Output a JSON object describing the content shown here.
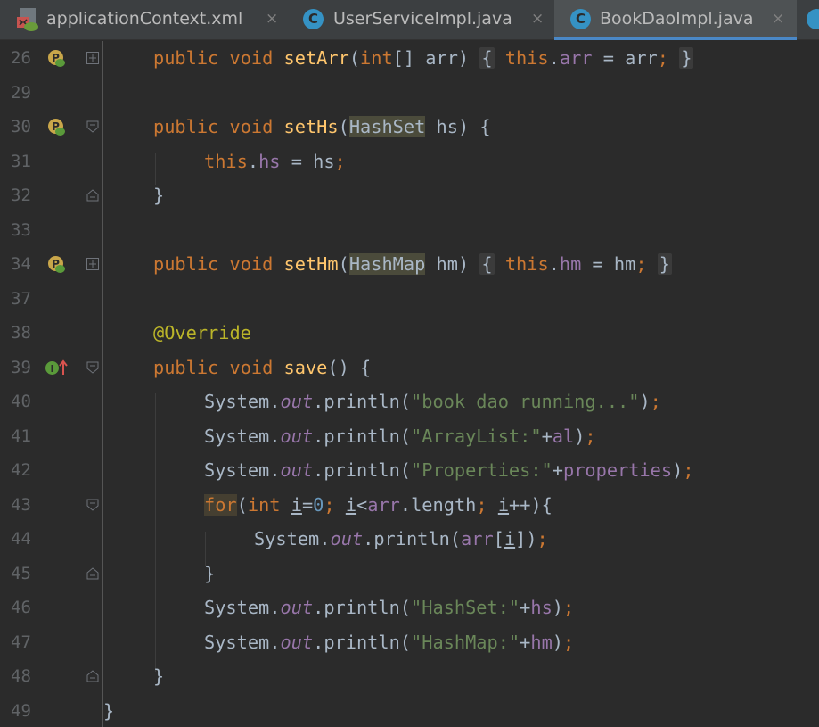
{
  "tabs": [
    {
      "label": "applicationContext.xml",
      "icon": "xml-file-icon",
      "active": false
    },
    {
      "label": "UserServiceImpl.java",
      "icon": "java-class-icon",
      "active": false
    },
    {
      "label": "BookDaoImpl.java",
      "icon": "java-class-icon",
      "active": true
    }
  ],
  "tab_close_glyph": "×",
  "colors": {
    "keyword": "#cc7832",
    "method": "#ffc66d",
    "field": "#9876aa",
    "string": "#6a8759",
    "annotation": "#bbb529",
    "number": "#6897bb",
    "text": "#a9b7c6",
    "background": "#2b2b2b",
    "active_tab_underline": "#4a88c7"
  },
  "line_numbers": [
    "26",
    "29",
    "30",
    "31",
    "32",
    "33",
    "34",
    "37",
    "38",
    "39",
    "40",
    "41",
    "42",
    "43",
    "44",
    "45",
    "46",
    "47",
    "48",
    "49"
  ],
  "code": {
    "l26": {
      "kw1": "public",
      "kw2": "void",
      "name": "setArr",
      "p1": "(",
      "type": "int",
      "p2": "[] arr) ",
      "ob": "{",
      "sp": " ",
      "this": "this",
      "dot": ".",
      "field": "arr",
      "rest": " = arr",
      "semi": ";",
      "sp2": " ",
      "cb": "}"
    },
    "l30": {
      "kw1": "public",
      "kw2": "void",
      "name": "setHs",
      "p1": "(",
      "type": "HashSet",
      "rest": " hs) {"
    },
    "l31": {
      "this": "this",
      "dot": ".",
      "field": "hs",
      "rest": " = hs",
      "semi": ";"
    },
    "l32": {
      "text": "}"
    },
    "l34": {
      "kw1": "public",
      "kw2": "void",
      "name": "setHm",
      "p1": "(",
      "type": "HashMap",
      "p2": " hm) ",
      "ob": "{",
      "sp": " ",
      "this": "this",
      "dot": ".",
      "field": "hm",
      "rest": " = hm",
      "semi": ";",
      "sp2": " ",
      "cb": "}"
    },
    "l38": {
      "ann": "@Override"
    },
    "l39": {
      "kw1": "public",
      "kw2": "void",
      "name": "save",
      "rest": "() {"
    },
    "l40": {
      "cls": "System.",
      "out": "out",
      "call": ".println(",
      "str": "\"book dao running...\"",
      "end": ")",
      "semi": ";"
    },
    "l41": {
      "cls": "System.",
      "out": "out",
      "call": ".println(",
      "str": "\"ArrayList:\"",
      "plus": "+",
      "field": "al",
      "end": ")",
      "semi": ";"
    },
    "l42": {
      "cls": "System.",
      "out": "out",
      "call": ".println(",
      "str": "\"Properties:\"",
      "plus": "+",
      "field": "properties",
      "end": ")",
      "semi": ";"
    },
    "l43": {
      "kw": "for",
      "p1": "(",
      "type": "int",
      "sp": " ",
      "v1": "i",
      "eq": "=",
      "zero": "0",
      "semi1": ";",
      "sp2": " ",
      "v2": "i",
      "lt": "<",
      "fld": "arr",
      "len": ".length",
      "semi2": ";",
      "sp3": " ",
      "v3": "i",
      "inc": "++){"
    },
    "l44": {
      "cls": "System.",
      "out": "out",
      "call": ".println(",
      "fld": "arr",
      "ob": "[",
      "v": "i",
      "cb": "])",
      "semi": ";"
    },
    "l45": {
      "text": "}"
    },
    "l46": {
      "cls": "System.",
      "out": "out",
      "call": ".println(",
      "str": "\"HashSet:\"",
      "plus": "+",
      "field": "hs",
      "end": ")",
      "semi": ";"
    },
    "l47": {
      "cls": "System.",
      "out": "out",
      "call": ".println(",
      "str": "\"HashMap:\"",
      "plus": "+",
      "field": "hm",
      "end": ")",
      "semi": ";"
    },
    "l48": {
      "text": "}"
    },
    "l49": {
      "text": "}"
    }
  },
  "gutter_icons": {
    "bean": "spring-property-icon",
    "implements": "implements-method-icon",
    "implements_letter": "I"
  }
}
